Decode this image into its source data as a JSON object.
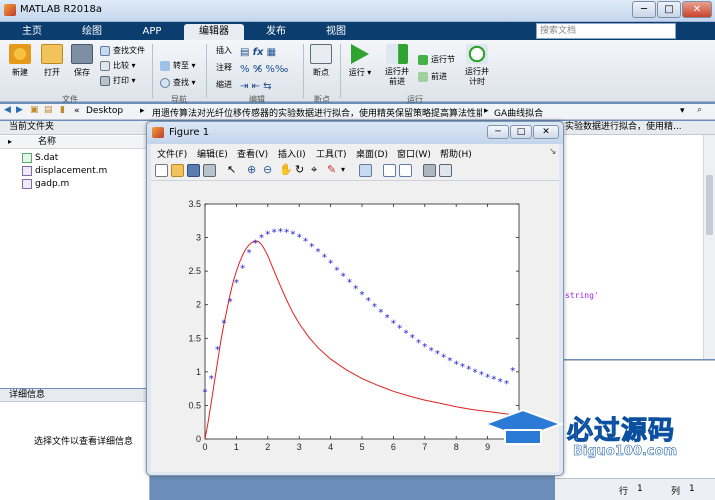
{
  "window": {
    "title": "MATLAB R2018a",
    "min": "─",
    "max": "□",
    "close": "✕"
  },
  "search": {
    "placeholder": "搜索文档"
  },
  "tabs": [
    {
      "label": "主页"
    },
    {
      "label": "绘图"
    },
    {
      "label": "APP"
    },
    {
      "label": "编辑器"
    },
    {
      "label": "发布"
    },
    {
      "label": "视图"
    }
  ],
  "ribbon": {
    "new": "新建",
    "open": "打开",
    "save": "保存",
    "find_files": "查找文件",
    "compare": "比较",
    "print": "打印",
    "goto": "转至",
    "find": "查找",
    "insert": "插入",
    "comment": "注释",
    "indent": "缩进",
    "breakpoints": "断点",
    "run": "运行",
    "run_advance": "运行并\n前进",
    "run_section": "运行节",
    "advance": "前进",
    "run_time": "运行并\n计时",
    "groups": {
      "file": "文件",
      "nav": "导航",
      "edit": "编辑",
      "breakpoints": "断点",
      "run": "运行"
    }
  },
  "address": {
    "sep": "«",
    "crumbs": [
      "Desktop",
      "用遗传算法对光纤位移传感器的实验数据进行拟合，使用精英保留策略提高算法性能",
      "GA曲线拟合"
    ]
  },
  "current_folder": {
    "title": "当前文件夹",
    "col_name": "名称",
    "files": [
      "S.dat",
      "displacement.m",
      "gadp.m"
    ]
  },
  "details": {
    "title": "详细信息",
    "empty": "选择文件以查看详细信息"
  },
  "editor": {
    "tab_text": "实验数据进行拟合，使用精...",
    "code_fragment": "string'"
  },
  "status": {
    "row_label": "行",
    "row": "1",
    "col_label": "列",
    "col": "1"
  },
  "figure": {
    "title": "Figure 1",
    "menus": [
      "文件(F)",
      "编辑(E)",
      "查看(V)",
      "插入(I)",
      "工具(T)",
      "桌面(D)",
      "窗口(W)",
      "帮助(H)"
    ]
  },
  "watermark": {
    "brand": "必过源码",
    "url": "Biguo100.com"
  },
  "colors": {
    "curve": "#e02020",
    "points": "#1a1ad8",
    "tabbar": "#0b3d6e"
  },
  "chart_data": {
    "type": "scatter",
    "xlim": [
      0,
      10
    ],
    "ylim": [
      0,
      3.5
    ],
    "x_ticks": [
      0,
      1,
      2,
      3,
      4,
      5,
      6,
      7,
      8,
      9
    ],
    "y_ticks": [
      0,
      0.5,
      1,
      1.5,
      2,
      2.5,
      3,
      3.5
    ],
    "series": [
      {
        "marker": "*",
        "color": "#1a1ad8",
        "x": [
          0,
          0.2,
          0.4,
          0.6,
          0.8,
          1.0,
          1.2,
          1.4,
          1.6,
          1.8,
          2.0,
          2.2,
          2.4,
          2.6,
          2.8,
          3.0,
          3.2,
          3.4,
          3.6,
          3.8,
          4.0,
          4.2,
          4.4,
          4.6,
          4.8,
          5.0,
          5.2,
          5.4,
          5.6,
          5.8,
          6.0,
          6.2,
          6.4,
          6.6,
          6.8,
          7.0,
          7.2,
          7.4,
          7.6,
          7.8,
          8.0,
          8.2,
          8.4,
          8.6,
          8.8,
          9.0,
          9.2,
          9.4,
          9.6,
          9.8
        ],
        "y": [
          0.7,
          0.9,
          1.33,
          1.73,
          2.05,
          2.33,
          2.55,
          2.78,
          2.92,
          3.0,
          3.05,
          3.08,
          3.09,
          3.08,
          3.05,
          3.01,
          2.95,
          2.87,
          2.79,
          2.71,
          2.62,
          2.52,
          2.43,
          2.34,
          2.24,
          2.15,
          2.06,
          1.97,
          1.89,
          1.81,
          1.73,
          1.65,
          1.58,
          1.51,
          1.44,
          1.38,
          1.32,
          1.27,
          1.22,
          1.17,
          1.12,
          1.08,
          1.04,
          1.0,
          0.96,
          0.92,
          0.89,
          0.86,
          0.83,
          1.02
        ]
      },
      {
        "line": "solid",
        "color": "#e02020",
        "x": [
          0,
          0.1,
          0.2,
          0.3,
          0.4,
          0.5,
          0.6,
          0.7,
          0.8,
          0.9,
          1.0,
          1.1,
          1.2,
          1.3,
          1.4,
          1.5,
          1.6,
          1.7,
          1.8,
          1.9,
          2.0,
          2.2,
          2.4,
          2.6,
          2.8,
          3.0,
          3.3,
          3.6,
          4.0,
          4.5,
          5.0,
          5.5,
          6.0,
          6.5,
          7.0,
          7.5,
          8.0,
          8.5,
          9.0,
          9.5,
          10.0
        ],
        "y": [
          0,
          0.25,
          0.55,
          0.85,
          1.15,
          1.45,
          1.7,
          1.93,
          2.15,
          2.35,
          2.5,
          2.63,
          2.74,
          2.83,
          2.89,
          2.93,
          2.95,
          2.94,
          2.9,
          2.82,
          2.73,
          2.5,
          2.28,
          2.07,
          1.88,
          1.72,
          1.52,
          1.36,
          1.19,
          1.03,
          0.9,
          0.8,
          0.71,
          0.64,
          0.58,
          0.53,
          0.48,
          0.44,
          0.41,
          0.38,
          0.35
        ]
      }
    ]
  }
}
